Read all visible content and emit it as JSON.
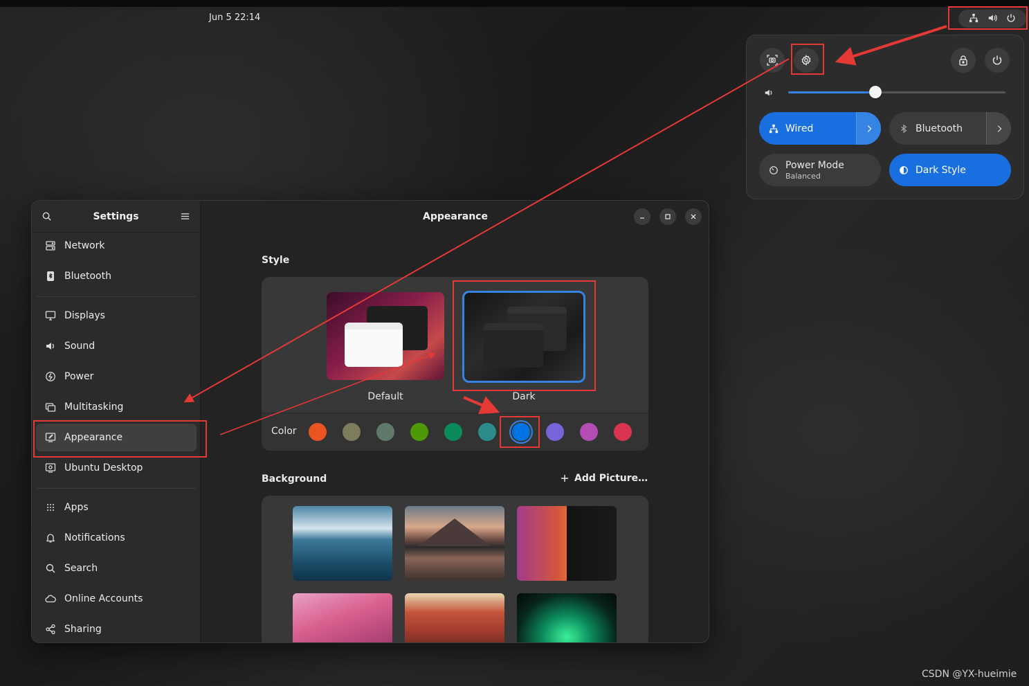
{
  "topbar": {
    "clock": "Jun 5  22:14"
  },
  "quick_settings": {
    "volume_percent": 40,
    "wired": {
      "label": "Wired"
    },
    "bluetooth": {
      "label": "Bluetooth"
    },
    "power_mode": {
      "label": "Power Mode",
      "sub": "Balanced"
    },
    "dark_style": {
      "label": "Dark Style"
    }
  },
  "settings": {
    "sidebar_title": "Settings",
    "items": [
      {
        "label": "Network",
        "icon": "network-icon"
      },
      {
        "label": "Bluetooth",
        "icon": "bluetooth-icon"
      },
      {
        "label": "Displays",
        "icon": "display-icon"
      },
      {
        "label": "Sound",
        "icon": "speaker-icon"
      },
      {
        "label": "Power",
        "icon": "power-icon"
      },
      {
        "label": "Multitasking",
        "icon": "multitasking-icon"
      },
      {
        "label": "Appearance",
        "icon": "appearance-icon"
      },
      {
        "label": "Ubuntu Desktop",
        "icon": "ubuntu-desktop-icon"
      },
      {
        "label": "Apps",
        "icon": "apps-grid-icon"
      },
      {
        "label": "Notifications",
        "icon": "bell-icon"
      },
      {
        "label": "Search",
        "icon": "search-icon"
      },
      {
        "label": "Online Accounts",
        "icon": "cloud-icon"
      },
      {
        "label": "Sharing",
        "icon": "share-icon"
      }
    ],
    "page_title": "Appearance",
    "style_section": "Style",
    "style_options": [
      {
        "label": "Default"
      },
      {
        "label": "Dark"
      }
    ],
    "color_label": "Color",
    "colors": [
      "#e95420",
      "#7d7d5e",
      "#5f7a6b",
      "#4e9a06",
      "#0b8a5c",
      "#2c8b8b",
      "#0073e5",
      "#7764d8",
      "#b34cb3",
      "#da3450"
    ],
    "selected_color": "#0073e5",
    "background_section": "Background",
    "add_picture": "Add Picture…"
  },
  "watermark": "CSDN @YX-hueimie"
}
